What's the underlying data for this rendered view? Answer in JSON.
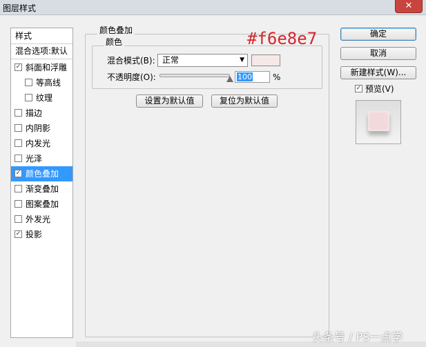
{
  "window": {
    "title": "图层样式",
    "close_glyph": "✕"
  },
  "styles_list": {
    "header": "样式",
    "blend_options": "混合选项:默认",
    "items": [
      {
        "label": "斜面和浮雕",
        "checked": true
      },
      {
        "label": "等高线",
        "checked": false
      },
      {
        "label": "纹理",
        "checked": false
      },
      {
        "label": "描边",
        "checked": false
      },
      {
        "label": "内阴影",
        "checked": false
      },
      {
        "label": "内发光",
        "checked": false
      },
      {
        "label": "光泽",
        "checked": false
      },
      {
        "label": "颜色叠加",
        "checked": true,
        "selected": true
      },
      {
        "label": "渐变叠加",
        "checked": false
      },
      {
        "label": "图案叠加",
        "checked": false
      },
      {
        "label": "外发光",
        "checked": false
      },
      {
        "label": "投影",
        "checked": true
      }
    ]
  },
  "color_overlay": {
    "title": "颜色叠加",
    "color_group_title": "颜色",
    "annotation": "#f6e8e7",
    "blend_mode_label": "混合模式(B):",
    "blend_mode_value": "正常",
    "swatch_color": "#f6e8e7",
    "opacity_label": "不透明度(O):",
    "opacity_value": "100",
    "opacity_unit": "%",
    "opacity_fraction": 1.0,
    "set_default_button": "设置为默认值",
    "reset_default_button": "复位为默认值"
  },
  "actions": {
    "ok": "确定",
    "cancel": "取消",
    "new_style": "新建样式(W)...",
    "preview_label": "预览(V)",
    "preview_checked": true
  },
  "watermark": "头条号 / PS一点学",
  "icons": {
    "checkbox_checked": "✓",
    "dropdown": "chevron-down-icon",
    "slider_thumb": "triangle-up-icon"
  }
}
